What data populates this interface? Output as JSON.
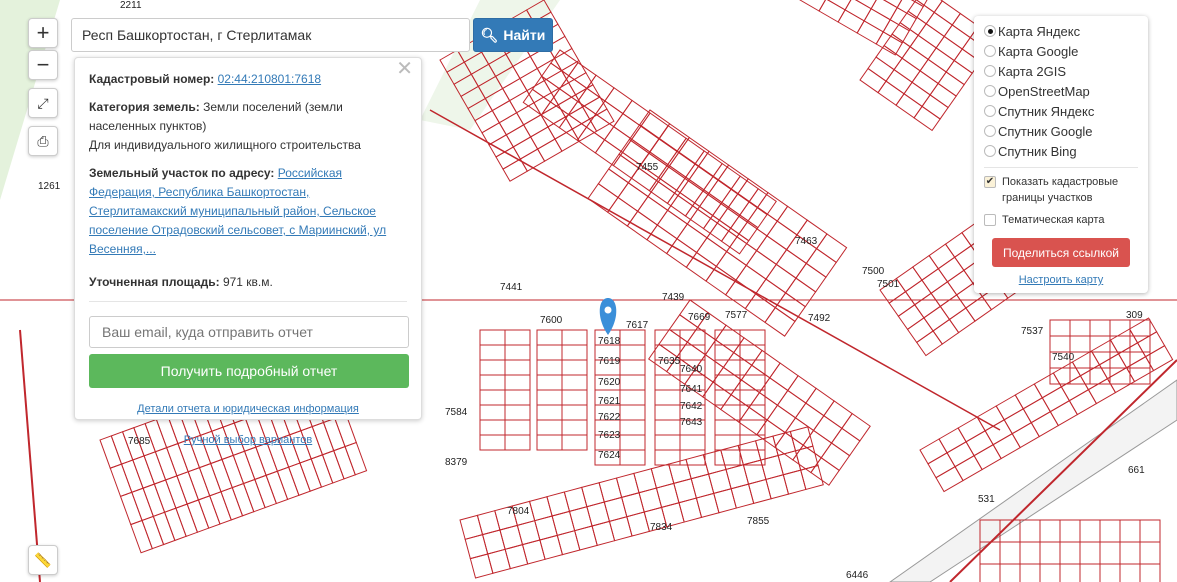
{
  "search": {
    "value": "Респ Башкортостан, г Стерлитамак",
    "button": "Найти"
  },
  "controls": {
    "zoom_in": "+",
    "zoom_out": "−"
  },
  "popup": {
    "cadastral_label": "Кадастровый номер:",
    "cadastral_value": "02:44:210801:7618",
    "category_label": "Категория земель:",
    "category_value": "Земли поселений (земли населенных пунктов)",
    "usage": "Для индивидуального жилищного строительства",
    "address_label": "Земельный участок по адресу:",
    "address_value": "Российская Федерация, Республика Башкортостан, Стерлитамакский муниципальный район, Сельское поселение Отрадовский сельсовет, с Мариинский, ул Весенняя,...",
    "area_label": "Уточненная площадь:",
    "area_value": "971 кв.м.",
    "email_placeholder": "Ваш email, куда отправить отчет",
    "report_button": "Получить подробный отчет",
    "details_link": "Детали отчета и юридическая информация",
    "manual_link": "Ручной выбор вариантов"
  },
  "layers": {
    "options": [
      "Карта Яндекс",
      "Карта Google",
      "Карта 2GIS",
      "OpenStreetMap",
      "Спутник Яндекс",
      "Спутник Google",
      "Спутник Bing"
    ],
    "selected": 0,
    "show_borders": "Показать кадастровые границы участков",
    "thematic": "Тематическая карта",
    "share_button": "Поделиться ссылкой",
    "configure_link": "Настроить карту"
  },
  "map_labels": [
    "7600",
    "7617",
    "7618",
    "7619",
    "7620",
    "7621",
    "7622",
    "7623",
    "7624",
    "7635",
    "7640",
    "7641",
    "7642",
    "7643",
    "7439",
    "7577",
    "7669",
    "7492",
    "7500",
    "7501",
    "7540",
    "7537",
    "7584",
    "7685",
    "8379",
    "7804",
    "7834",
    "7855",
    "531",
    "661",
    "309",
    "1261",
    "2211",
    "6446",
    "7455",
    "7463",
    "7441"
  ],
  "colors": {
    "parcel_line": "#c0272d",
    "link": "#337ab7"
  }
}
